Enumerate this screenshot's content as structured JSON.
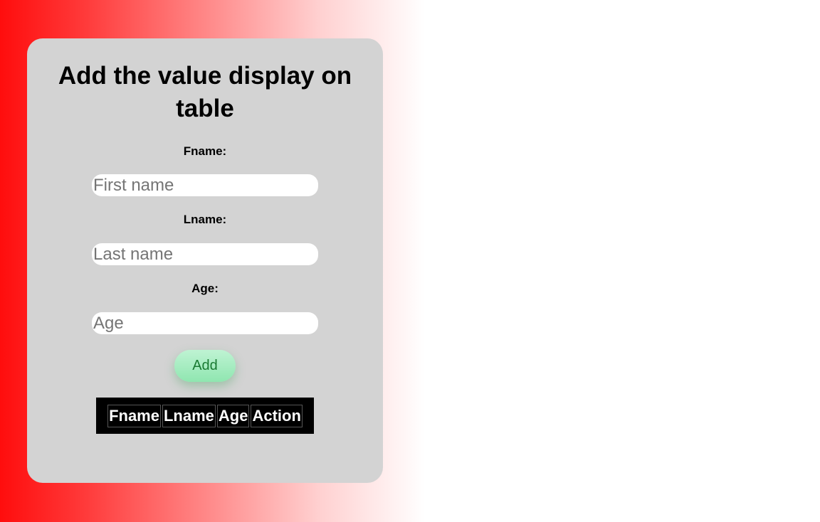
{
  "form": {
    "title": "Add the value display on table",
    "fname_label": "Fname:",
    "fname_placeholder": "First name",
    "lname_label": "Lname:",
    "lname_placeholder": "Last name",
    "age_label": "Age:",
    "age_placeholder": "Age",
    "add_label": "Add"
  },
  "table": {
    "headers": [
      "Fname",
      "Lname",
      "Age",
      "Action"
    ]
  },
  "colors": {
    "card": "#d3d3d3",
    "gradient_start": "#ff0d0d",
    "button": "#a6ecc1",
    "button_text": "#1a7a33",
    "table_bg": "#000000"
  }
}
